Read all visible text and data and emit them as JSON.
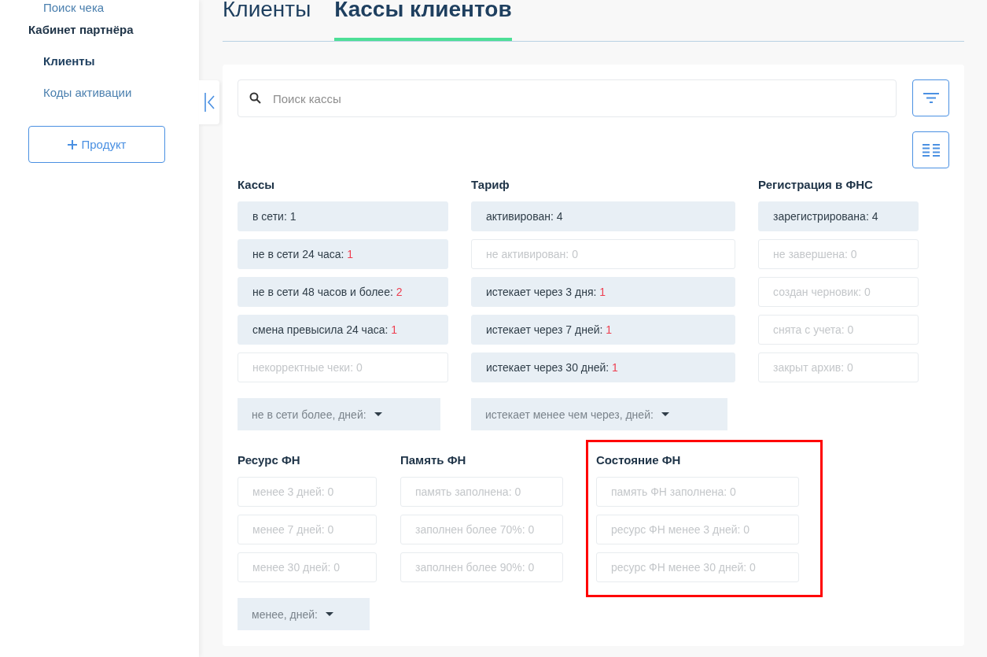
{
  "sidebar": {
    "items": [
      {
        "label": "Поиск чека",
        "kind": "link",
        "selected": false
      }
    ],
    "section_title": "Кабинет партнёра",
    "sub_items": [
      {
        "label": "Клиенты",
        "selected": true
      },
      {
        "label": "Коды активации",
        "selected": false
      }
    ],
    "add_button": {
      "label": "Продукт"
    }
  },
  "tabs": [
    {
      "label": "Клиенты",
      "selected": false
    },
    {
      "label": "Кассы клиентов",
      "selected": true
    }
  ],
  "search": {
    "placeholder": "Поиск кассы"
  },
  "filter_rows": [
    {
      "groups": [
        {
          "title": "Кассы",
          "highlighted": false,
          "chips": [
            {
              "label": "в сети:",
              "count": "1",
              "disabled": false,
              "alert": false
            },
            {
              "label": "не в сети 24 часа:",
              "count": "1",
              "disabled": false,
              "alert": true
            },
            {
              "label": "не в сети 48 часов и более:",
              "count": "2",
              "disabled": false,
              "alert": true
            },
            {
              "label": "смена превысила 24 часа:",
              "count": "1",
              "disabled": false,
              "alert": true
            },
            {
              "label": "некорректные чеки:",
              "count": "0",
              "disabled": true,
              "alert": false
            }
          ],
          "dropdown": "не в сети более, дней:"
        },
        {
          "title": "Тариф",
          "highlighted": false,
          "chips": [
            {
              "label": "активирован:",
              "count": "4",
              "disabled": false,
              "alert": false
            },
            {
              "label": "не активирован:",
              "count": "0",
              "disabled": true,
              "alert": false
            },
            {
              "label": "истекает через 3 дня:",
              "count": "1",
              "disabled": false,
              "alert": true
            },
            {
              "label": "истекает через 7 дней:",
              "count": "1",
              "disabled": false,
              "alert": true
            },
            {
              "label": "истекает через 30 дней:",
              "count": "1",
              "disabled": false,
              "alert": true
            }
          ],
          "dropdown": "истекает менее чем через, дней:"
        },
        {
          "title": "Регистрация в ФНС",
          "highlighted": false,
          "chips": [
            {
              "label": "зарегистрирована:",
              "count": "4",
              "disabled": false,
              "alert": false
            },
            {
              "label": "не завершена:",
              "count": "0",
              "disabled": true,
              "alert": false
            },
            {
              "label": "создан черновик:",
              "count": "0",
              "disabled": true,
              "alert": false
            },
            {
              "label": "снята с учета:",
              "count": "0",
              "disabled": true,
              "alert": false
            },
            {
              "label": "закрыт архив:",
              "count": "0",
              "disabled": true,
              "alert": false
            }
          ]
        }
      ]
    },
    {
      "groups": [
        {
          "title": "Ресурс ФН",
          "highlighted": false,
          "chips": [
            {
              "label": "менее 3 дней:",
              "count": "0",
              "disabled": true,
              "alert": false
            },
            {
              "label": "менее 7 дней:",
              "count": "0",
              "disabled": true,
              "alert": false
            },
            {
              "label": "менее 30 дней:",
              "count": "0",
              "disabled": true,
              "alert": false
            }
          ],
          "dropdown": "менее, дней:"
        },
        {
          "title": "Память ФН",
          "highlighted": false,
          "chips": [
            {
              "label": "память заполнена:",
              "count": "0",
              "disabled": true,
              "alert": false
            },
            {
              "label": "заполнен более 70%:",
              "count": "0",
              "disabled": true,
              "alert": false
            },
            {
              "label": "заполнен более 90%:",
              "count": "0",
              "disabled": true,
              "alert": false
            }
          ]
        },
        {
          "title": "Состояние ФН",
          "highlighted": true,
          "chips": [
            {
              "label": "память ФН заполнена:",
              "count": "0",
              "disabled": true,
              "alert": false
            },
            {
              "label": "ресурс ФН менее 3 дней:",
              "count": "0",
              "disabled": true,
              "alert": false
            },
            {
              "label": "ресурс ФН менее 30 дней:",
              "count": "0",
              "disabled": true,
              "alert": false
            }
          ]
        }
      ]
    }
  ]
}
